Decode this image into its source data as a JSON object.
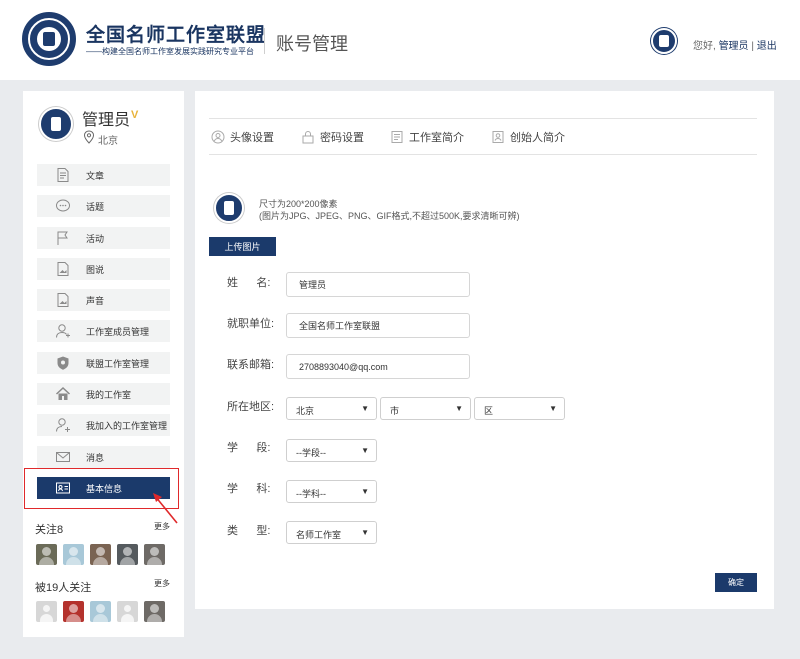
{
  "header": {
    "brand_title": "全国名师工作室联盟",
    "brand_subtitle": "——构建全国名师工作室发展实践研究专业平台",
    "page_title": "账号管理",
    "greeting_prefix": "您好,",
    "username": "管理员",
    "separator": "|",
    "logout": "退出"
  },
  "sidebar": {
    "name": "管理员",
    "vip_badge": "V",
    "city": "北京",
    "menu": [
      {
        "label": "文章",
        "icon": "document-icon"
      },
      {
        "label": "话题",
        "icon": "chat-bubble-icon"
      },
      {
        "label": "活动",
        "icon": "flag-icon"
      },
      {
        "label": "图说",
        "icon": "image-icon"
      },
      {
        "label": "声音",
        "icon": "audio-file-icon"
      },
      {
        "label": "工作室成员管理",
        "icon": "user-icon"
      },
      {
        "label": "联盟工作室管理",
        "icon": "shield-icon"
      },
      {
        "label": "我的工作室",
        "icon": "home-icon"
      },
      {
        "label": "我加入的工作室管理",
        "icon": "user-add-icon"
      },
      {
        "label": "消息",
        "icon": "mail-icon"
      },
      {
        "label": "基本信息",
        "icon": "id-card-icon",
        "active": true
      }
    ],
    "following_title": "关注8",
    "followers_title": "被19人关注",
    "more": "更多"
  },
  "tabs": [
    {
      "label": "头像设置",
      "icon": "avatar-icon"
    },
    {
      "label": "密码设置",
      "icon": "lock-icon"
    },
    {
      "label": "工作室简介",
      "icon": "book-icon"
    },
    {
      "label": "创始人简介",
      "icon": "portrait-icon"
    }
  ],
  "avatar_upload": {
    "hint_size": "尺寸为200*200像素",
    "hint_format": "(图片为JPG、JPEG、PNG、GIF格式,不超过500K,要求清晰可辨)",
    "button": "上传图片"
  },
  "form": {
    "name_label": "姓      名:",
    "name_value": "管理员",
    "unit_label": "就职单位:",
    "unit_value": "全国名师工作室联盟",
    "email_label": "联系邮箱:",
    "email_value": "2708893040@qq.com",
    "region_label": "所在地区:",
    "province": "北京",
    "city": "市",
    "district": "区",
    "stage_label": "学      段:",
    "stage": "--学段--",
    "subject_label": "学      科:",
    "subject": "--学科--",
    "type_label": "类      型:",
    "type": "名师工作室",
    "caret": "▼"
  },
  "confirm": "确定",
  "colors": {
    "primary": "#1b3a6b",
    "highlight": "#e0292b",
    "background": "#e9ebee"
  }
}
